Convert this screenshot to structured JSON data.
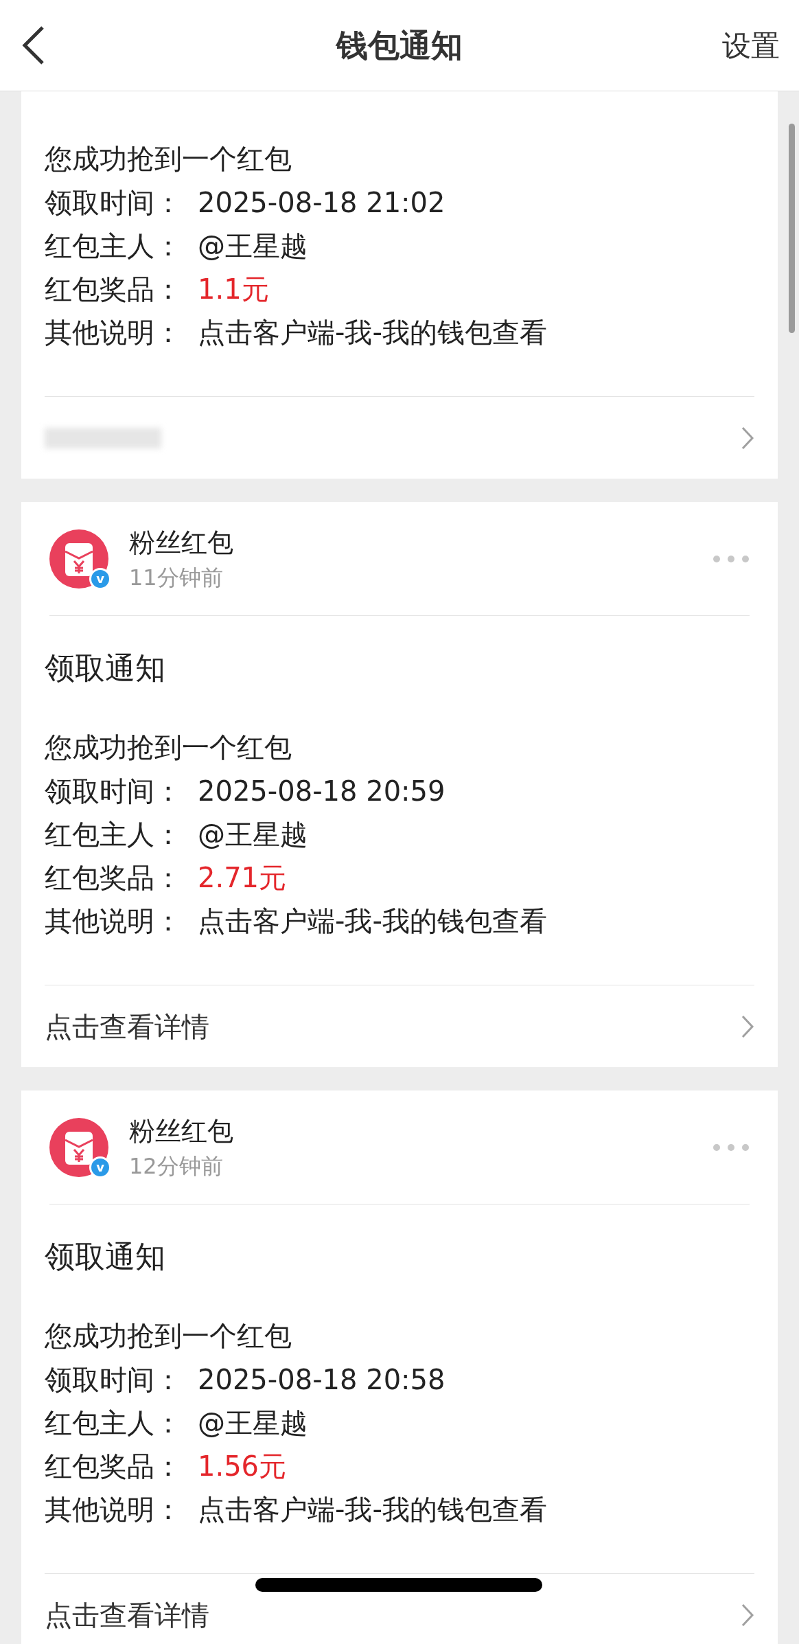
{
  "header": {
    "title": "钱包通知",
    "action": "设置"
  },
  "notices": [
    {
      "kind": "partial",
      "intro": "您成功抢到一个红包",
      "fields": [
        {
          "label": "领取时间：",
          "value": "2025-08-18 21:02",
          "kind": "plain"
        },
        {
          "label": "红包主人：",
          "value": "@王星越",
          "kind": "plain"
        },
        {
          "label": "红包奖品：",
          "value": "1.1元",
          "kind": "prize"
        },
        {
          "label": "其他说明：",
          "value": "点击客户端-我-我的钱包查看",
          "kind": "plain"
        }
      ]
    },
    {
      "kind": "full",
      "sender": "粉丝红包",
      "badge": "v",
      "time": "11分钟前",
      "title": "领取通知",
      "intro": "您成功抢到一个红包",
      "fields": [
        {
          "label": "领取时间：",
          "value": "2025-08-18 20:59",
          "kind": "plain"
        },
        {
          "label": "红包主人：",
          "value": "@王星越",
          "kind": "plain"
        },
        {
          "label": "红包奖品：",
          "value": "2.71元",
          "kind": "prize"
        },
        {
          "label": "其他说明：",
          "value": "点击客户端-我-我的钱包查看",
          "kind": "plain"
        }
      ],
      "link": "点击查看详情"
    },
    {
      "kind": "full",
      "sender": "粉丝红包",
      "badge": "v",
      "time": "12分钟前",
      "title": "领取通知",
      "intro": "您成功抢到一个红包",
      "fields": [
        {
          "label": "领取时间：",
          "value": "2025-08-18 20:58",
          "kind": "plain"
        },
        {
          "label": "红包主人：",
          "value": "@王星越",
          "kind": "plain"
        },
        {
          "label": "红包奖品：",
          "value": "1.56元",
          "kind": "prize"
        },
        {
          "label": "其他说明：",
          "value": "点击客户端-我-我的钱包查看",
          "kind": "plain"
        }
      ],
      "link": "点击查看详情"
    }
  ]
}
